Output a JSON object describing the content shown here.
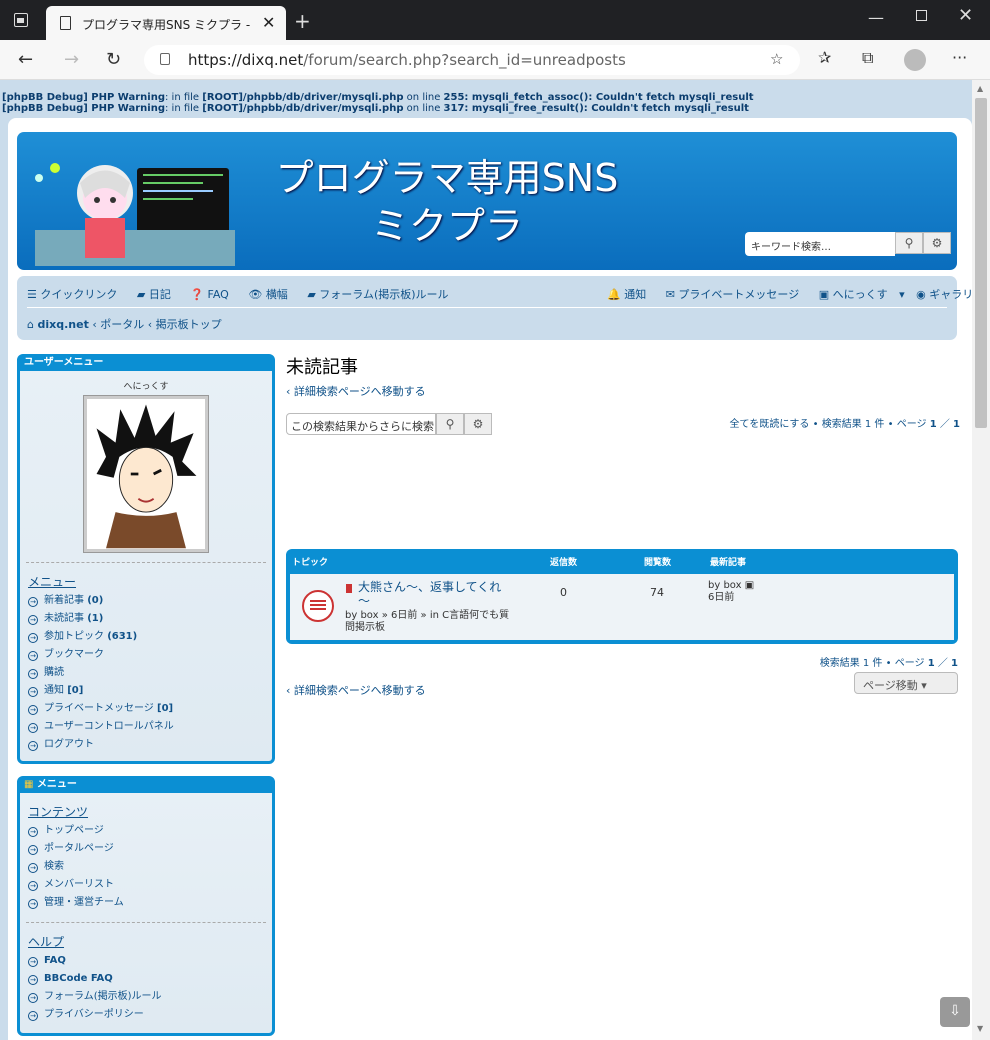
{
  "browser": {
    "tab_title": "プログラマ専用SNS ミクプラ - 未読記事",
    "url_host": "https://dixq.net",
    "url_path": "/forum/search.php?search_id=unreadposts"
  },
  "debug": {
    "line1_prefix": "[phpBB Debug] PHP Warning",
    "line1_mid": ": in file ",
    "line1_file": "[ROOT]/phpbb/db/driver/mysqli.php",
    "line1_online": " on line ",
    "line1_no": "255",
    "line1_msg": ": mysqli_fetch_assoc(): Couldn't fetch mysqli_result",
    "line2_prefix": "[phpBB Debug] PHP Warning",
    "line2_mid": ": in file ",
    "line2_file": "[ROOT]/phpbb/db/driver/mysqli.php",
    "line2_online": " on line ",
    "line2_no": "317",
    "line2_msg": ": mysqli_free_result(): Couldn't fetch mysqli_result"
  },
  "header": {
    "title_line1": "プログラマ専用SNS",
    "title_line2": "ミクプラ",
    "search_placeholder": "キーワード検索…"
  },
  "nav": {
    "quick_links": "クイックリンク",
    "diary": "日記",
    "faq": "FAQ",
    "width": "横幅",
    "rules": "フォーラム(掲示板)ルール",
    "notifications": "通知",
    "private_messages": "プライベートメッセージ",
    "username": "へにっくす",
    "gallery": "ギャラリー"
  },
  "breadcrumbs": [
    "dixq.net",
    "ポータル",
    "掲示板トップ"
  ],
  "user_menu": {
    "title": "ユーザーメニュー",
    "username": "へにっくす",
    "menu_title": "メニュー",
    "items": [
      {
        "label": "新着記事",
        "count": "(0)"
      },
      {
        "label": "未読記事",
        "count": "(1)"
      },
      {
        "label": "参加トピック",
        "count": "(631)"
      },
      {
        "label": "ブックマーク",
        "count": ""
      },
      {
        "label": "購読",
        "count": ""
      },
      {
        "label": "通知",
        "count": "[0]"
      },
      {
        "label": "プライベートメッセージ",
        "count": "[0]"
      },
      {
        "label": "ユーザーコントロールパネル",
        "count": ""
      },
      {
        "label": "ログアウト",
        "count": ""
      }
    ]
  },
  "menu": {
    "title": "メニュー",
    "contents_title": "コンテンツ",
    "contents": [
      "トップページ",
      "ポータルページ",
      "検索",
      "メンバーリスト",
      "管理・運営チーム"
    ],
    "help_title": "ヘルプ",
    "help": [
      "FAQ",
      "BBCode FAQ",
      "フォーラム(掲示板)ルール",
      "プライバシーポリシー"
    ]
  },
  "main": {
    "title": "未読記事",
    "back_link": "詳細検索ページへ移動する",
    "refine_placeholder": "この検索結果からさらに検索",
    "mark_read": "全てを既読にする",
    "result_summary": "検索結果 1 件",
    "page_label": "ページ",
    "page_current": "1",
    "page_total": "1",
    "jump_label": "ページ移動"
  },
  "table": {
    "headers": {
      "topic": "トピック",
      "replies": "返信数",
      "views": "閲覧数",
      "last_post": "最新記事"
    },
    "row": {
      "title": "大熊さん～、返事してくれ～",
      "meta": "by box » 6日前 » in C言語何でも質問掲示板",
      "replies": "0",
      "views": "74",
      "last_by": "by box",
      "last_time": "6日前"
    }
  }
}
